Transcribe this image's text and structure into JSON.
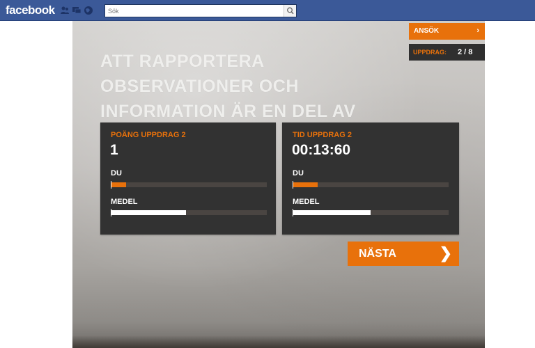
{
  "fb": {
    "logo": "facebook",
    "search_placeholder": "Sök",
    "brand_color": "#3b5998",
    "icons": [
      "friend-requests-icon",
      "messages-icon",
      "notifications-globe-icon",
      "search-icon"
    ]
  },
  "app": {
    "headline": "ATT RAPPORTERA OBSERVATIONER OCH INFORMATION ÄR EN DEL AV VÅR VERKLIGHET.",
    "apply_label": "ANSÖK",
    "apply_chevron": "›",
    "mission_label": "UPPDRAG:",
    "mission_count": "2 / 8",
    "accent_color": "#e8710b",
    "next_label": "NÄSTA",
    "next_chevron": "❯"
  },
  "points_panel": {
    "title": "POÄNG UPPDRAG 2",
    "value": "1",
    "you_label": "DU",
    "you_fraction": 0.1,
    "average_label": "MEDEL",
    "average_fraction": 0.48
  },
  "time_panel": {
    "title": "TID UPPDRAG 2",
    "value": "00:13:60",
    "you_label": "DU",
    "you_fraction": 0.16,
    "average_label": "MEDEL",
    "average_fraction": 0.5
  }
}
